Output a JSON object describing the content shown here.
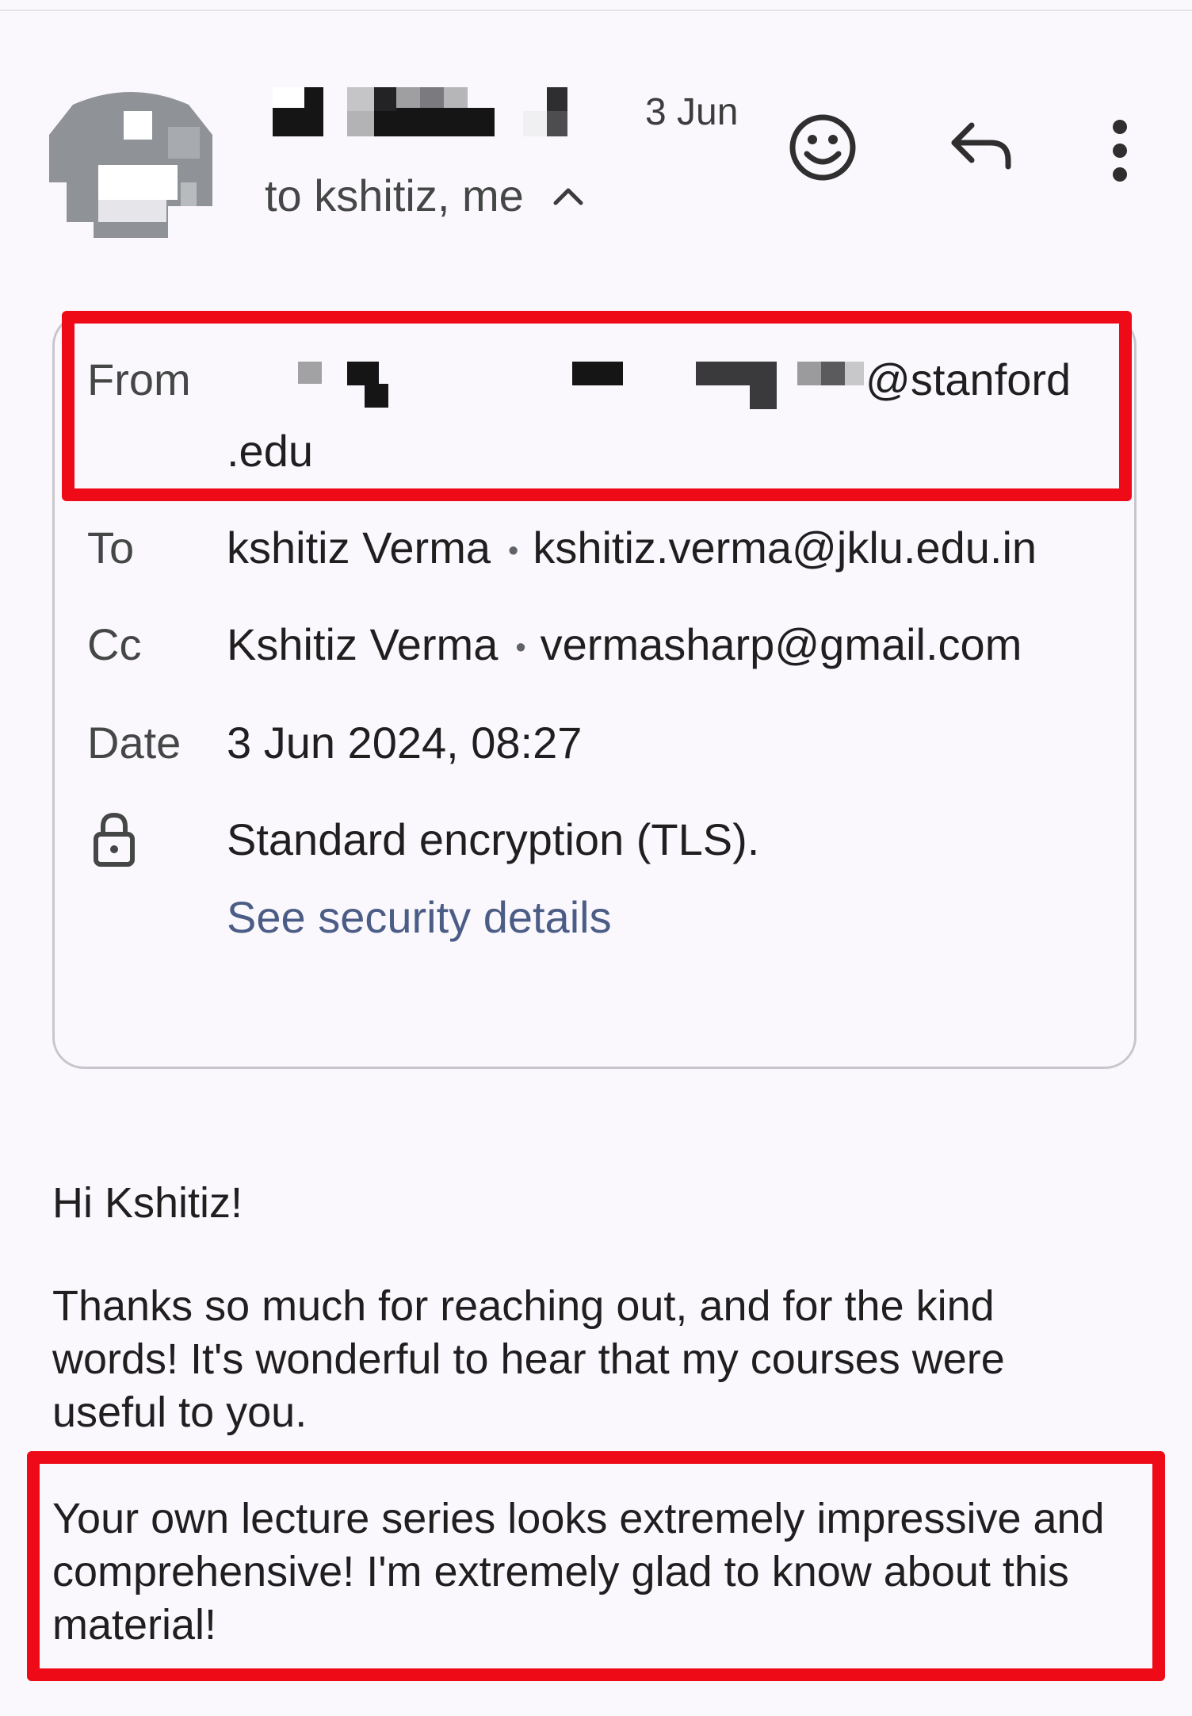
{
  "header": {
    "date": "3 Jun",
    "recipients": "to kshitiz, me"
  },
  "details": {
    "from_label": "From",
    "from_domain": "@stanford",
    "from_tld": ".edu",
    "to_label": "To",
    "to_name": "kshitiz Verma",
    "to_email": "kshitiz.verma@jklu.edu.in",
    "cc_label": "Cc",
    "cc_name": "Kshitiz Verma",
    "cc_email": "vermasharp@gmail.com",
    "date_label": "Date",
    "date_value": "3 Jun 2024, 08:27",
    "encryption": "Standard encryption (TLS).",
    "security_link": "See security details",
    "separator": "•"
  },
  "body": {
    "greeting": "Hi Kshitiz!",
    "para1": "Thanks so much for reaching out, and for the kind words! It's wonderful to hear that my courses were useful to you.",
    "para2": "Your own lecture series looks extremely impressive and comprehensive! I'm extremely glad to know about this material!"
  },
  "icons": {
    "emoji": "smiley-face-icon",
    "reply": "reply-arrow-icon",
    "more": "more-vertical-icon",
    "expand": "chevron-up-icon",
    "lock": "lock-icon"
  },
  "colors": {
    "background": "#fbf8fd",
    "highlight": "#ef0a18",
    "link": "#4b5d86",
    "card_border": "#c9c5cc"
  }
}
